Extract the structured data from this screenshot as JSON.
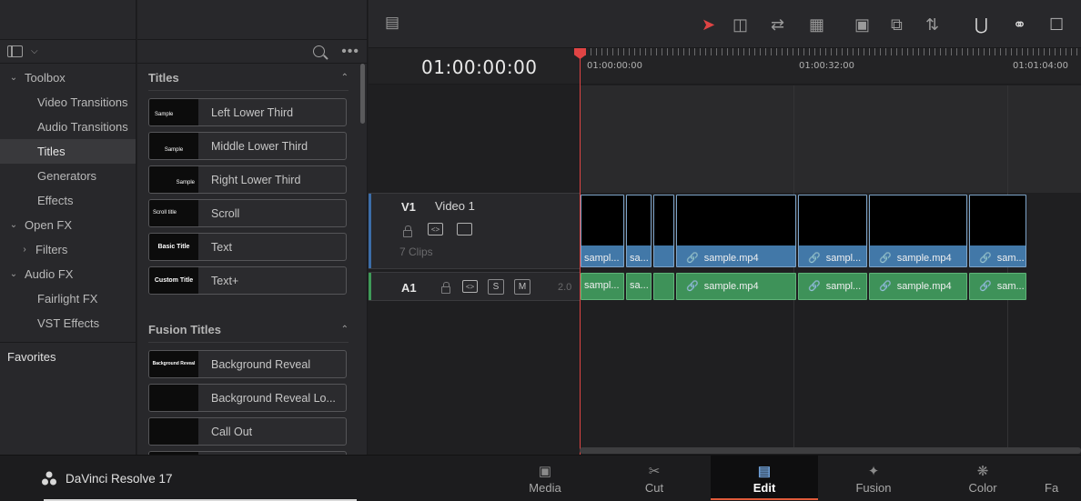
{
  "tree": {
    "items": [
      {
        "label": "Toolbox",
        "twisty": "v"
      },
      {
        "label": "Video Transitions"
      },
      {
        "label": "Audio Transitions"
      },
      {
        "label": "Titles"
      },
      {
        "label": "Generators"
      },
      {
        "label": "Effects"
      },
      {
        "label": "Open FX",
        "twisty": "v"
      },
      {
        "label": "Filters",
        "twisty": ">"
      },
      {
        "label": "Audio FX",
        "twisty": "v"
      },
      {
        "label": "Fairlight FX"
      },
      {
        "label": "VST Effects"
      }
    ],
    "favorites": "Favorites"
  },
  "titles_section": {
    "heading": "Titles",
    "items": [
      {
        "label": "Left Lower Third",
        "thumb_text": "Sample"
      },
      {
        "label": "Middle Lower Third",
        "thumb_text": "Sample"
      },
      {
        "label": "Right Lower Third",
        "thumb_text": "Sample"
      },
      {
        "label": "Scroll",
        "thumb_text": "Scroll title"
      },
      {
        "label": "Text",
        "thumb_text": "Basic Title"
      },
      {
        "label": "Text+",
        "thumb_text": "Custom Title"
      }
    ]
  },
  "fusion_section": {
    "heading": "Fusion Titles",
    "items": [
      {
        "label": "Background Reveal",
        "thumb_text": "Background Reveal"
      },
      {
        "label": "Background Reveal Lo...",
        "thumb_text": ""
      },
      {
        "label": "Call Out",
        "thumb_text": ""
      }
    ]
  },
  "timeline": {
    "timecode": "01:00:00:00",
    "ruler_labels": [
      "01:00:00:00",
      "01:00:32:00",
      "01:01:04:00"
    ],
    "v1": {
      "id": "V1",
      "name": "Video 1",
      "clip_count": "7 Clips"
    },
    "a1": {
      "id": "A1",
      "channels": "2.0",
      "solo": "S",
      "mute": "M"
    },
    "video_clips": [
      "sampl...",
      "sa...",
      "",
      "sample.mp4",
      "sampl...",
      "sample.mp4",
      "sam..."
    ],
    "audio_clips": [
      "sampl...",
      "sa...",
      "",
      "sample.mp4",
      "sampl...",
      "sample.mp4",
      "sam..."
    ],
    "playhead_color": "#e04444",
    "video_clip_color": "#4278a8",
    "audio_clip_color": "#3e9259"
  },
  "bottom_bar": {
    "app_name": "DaVinci Resolve 17",
    "tabs": [
      {
        "label": "Media",
        "icon": "media-icon"
      },
      {
        "label": "Cut",
        "icon": "cut-icon"
      },
      {
        "label": "Edit",
        "icon": "edit-icon",
        "active": true
      },
      {
        "label": "Fusion",
        "icon": "fusion-icon"
      },
      {
        "label": "Color",
        "icon": "color-icon"
      },
      {
        "label": "Fa",
        "icon": "fairlight-icon"
      }
    ],
    "accent": "#e05a3a"
  }
}
